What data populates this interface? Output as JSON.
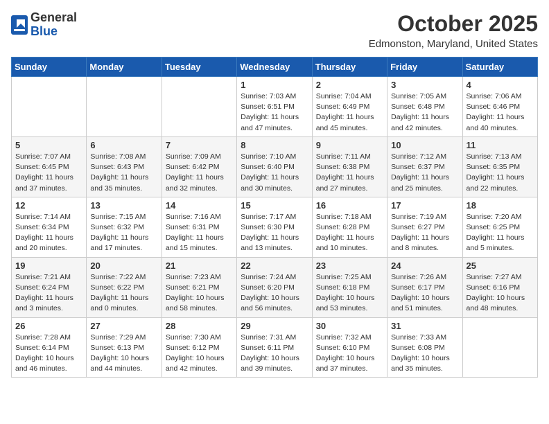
{
  "header": {
    "logo_general": "General",
    "logo_blue": "Blue",
    "month_title": "October 2025",
    "location": "Edmonston, Maryland, United States"
  },
  "weekdays": [
    "Sunday",
    "Monday",
    "Tuesday",
    "Wednesday",
    "Thursday",
    "Friday",
    "Saturday"
  ],
  "weeks": [
    [
      {
        "day": "",
        "info": ""
      },
      {
        "day": "",
        "info": ""
      },
      {
        "day": "",
        "info": ""
      },
      {
        "day": "1",
        "info": "Sunrise: 7:03 AM\nSunset: 6:51 PM\nDaylight: 11 hours\nand 47 minutes."
      },
      {
        "day": "2",
        "info": "Sunrise: 7:04 AM\nSunset: 6:49 PM\nDaylight: 11 hours\nand 45 minutes."
      },
      {
        "day": "3",
        "info": "Sunrise: 7:05 AM\nSunset: 6:48 PM\nDaylight: 11 hours\nand 42 minutes."
      },
      {
        "day": "4",
        "info": "Sunrise: 7:06 AM\nSunset: 6:46 PM\nDaylight: 11 hours\nand 40 minutes."
      }
    ],
    [
      {
        "day": "5",
        "info": "Sunrise: 7:07 AM\nSunset: 6:45 PM\nDaylight: 11 hours\nand 37 minutes."
      },
      {
        "day": "6",
        "info": "Sunrise: 7:08 AM\nSunset: 6:43 PM\nDaylight: 11 hours\nand 35 minutes."
      },
      {
        "day": "7",
        "info": "Sunrise: 7:09 AM\nSunset: 6:42 PM\nDaylight: 11 hours\nand 32 minutes."
      },
      {
        "day": "8",
        "info": "Sunrise: 7:10 AM\nSunset: 6:40 PM\nDaylight: 11 hours\nand 30 minutes."
      },
      {
        "day": "9",
        "info": "Sunrise: 7:11 AM\nSunset: 6:38 PM\nDaylight: 11 hours\nand 27 minutes."
      },
      {
        "day": "10",
        "info": "Sunrise: 7:12 AM\nSunset: 6:37 PM\nDaylight: 11 hours\nand 25 minutes."
      },
      {
        "day": "11",
        "info": "Sunrise: 7:13 AM\nSunset: 6:35 PM\nDaylight: 11 hours\nand 22 minutes."
      }
    ],
    [
      {
        "day": "12",
        "info": "Sunrise: 7:14 AM\nSunset: 6:34 PM\nDaylight: 11 hours\nand 20 minutes."
      },
      {
        "day": "13",
        "info": "Sunrise: 7:15 AM\nSunset: 6:32 PM\nDaylight: 11 hours\nand 17 minutes."
      },
      {
        "day": "14",
        "info": "Sunrise: 7:16 AM\nSunset: 6:31 PM\nDaylight: 11 hours\nand 15 minutes."
      },
      {
        "day": "15",
        "info": "Sunrise: 7:17 AM\nSunset: 6:30 PM\nDaylight: 11 hours\nand 13 minutes."
      },
      {
        "day": "16",
        "info": "Sunrise: 7:18 AM\nSunset: 6:28 PM\nDaylight: 11 hours\nand 10 minutes."
      },
      {
        "day": "17",
        "info": "Sunrise: 7:19 AM\nSunset: 6:27 PM\nDaylight: 11 hours\nand 8 minutes."
      },
      {
        "day": "18",
        "info": "Sunrise: 7:20 AM\nSunset: 6:25 PM\nDaylight: 11 hours\nand 5 minutes."
      }
    ],
    [
      {
        "day": "19",
        "info": "Sunrise: 7:21 AM\nSunset: 6:24 PM\nDaylight: 11 hours\nand 3 minutes."
      },
      {
        "day": "20",
        "info": "Sunrise: 7:22 AM\nSunset: 6:22 PM\nDaylight: 11 hours\nand 0 minutes."
      },
      {
        "day": "21",
        "info": "Sunrise: 7:23 AM\nSunset: 6:21 PM\nDaylight: 10 hours\nand 58 minutes."
      },
      {
        "day": "22",
        "info": "Sunrise: 7:24 AM\nSunset: 6:20 PM\nDaylight: 10 hours\nand 56 minutes."
      },
      {
        "day": "23",
        "info": "Sunrise: 7:25 AM\nSunset: 6:18 PM\nDaylight: 10 hours\nand 53 minutes."
      },
      {
        "day": "24",
        "info": "Sunrise: 7:26 AM\nSunset: 6:17 PM\nDaylight: 10 hours\nand 51 minutes."
      },
      {
        "day": "25",
        "info": "Sunrise: 7:27 AM\nSunset: 6:16 PM\nDaylight: 10 hours\nand 48 minutes."
      }
    ],
    [
      {
        "day": "26",
        "info": "Sunrise: 7:28 AM\nSunset: 6:14 PM\nDaylight: 10 hours\nand 46 minutes."
      },
      {
        "day": "27",
        "info": "Sunrise: 7:29 AM\nSunset: 6:13 PM\nDaylight: 10 hours\nand 44 minutes."
      },
      {
        "day": "28",
        "info": "Sunrise: 7:30 AM\nSunset: 6:12 PM\nDaylight: 10 hours\nand 42 minutes."
      },
      {
        "day": "29",
        "info": "Sunrise: 7:31 AM\nSunset: 6:11 PM\nDaylight: 10 hours\nand 39 minutes."
      },
      {
        "day": "30",
        "info": "Sunrise: 7:32 AM\nSunset: 6:10 PM\nDaylight: 10 hours\nand 37 minutes."
      },
      {
        "day": "31",
        "info": "Sunrise: 7:33 AM\nSunset: 6:08 PM\nDaylight: 10 hours\nand 35 minutes."
      },
      {
        "day": "",
        "info": ""
      }
    ]
  ]
}
